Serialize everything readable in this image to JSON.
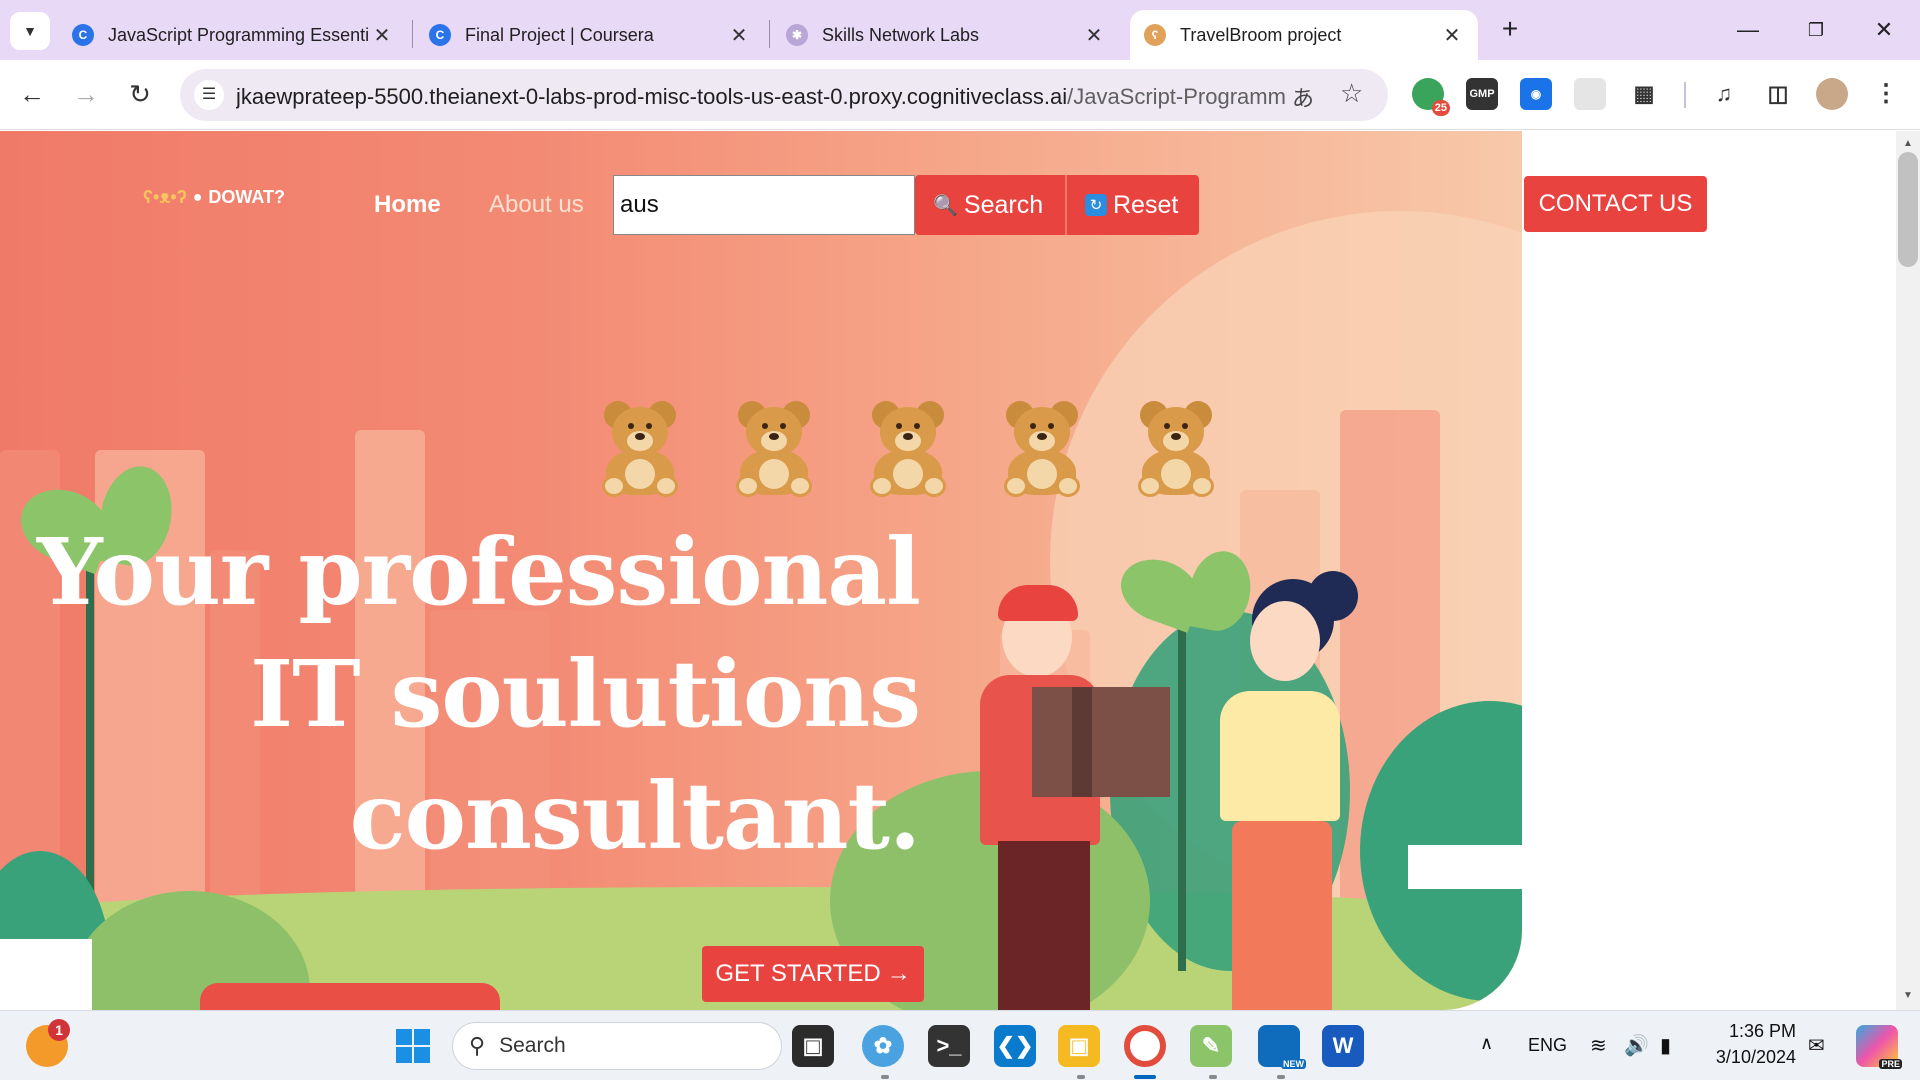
{
  "browser": {
    "tabs": [
      {
        "title": "JavaScript Programming Essenti",
        "favicon": "coursera-icon",
        "active": false
      },
      {
        "title": "Final Project | Coursera",
        "favicon": "coursera-icon",
        "active": false
      },
      {
        "title": "Skills Network Labs",
        "favicon": "skills-network-icon",
        "active": false
      },
      {
        "title": "TravelBroom project",
        "favicon": "bear-icon",
        "active": true
      }
    ],
    "close_glyph": "✕",
    "new_tab_glyph": "+",
    "url_host": "jkaewprateep-5500.theianext-0-labs-prod-misc-tools-us-east-0.proxy.cognitiveclass.ai",
    "url_path": "/JavaScript-Programming...",
    "extension_badge": "25",
    "extension_gmp": "GMP"
  },
  "page": {
    "logo_text": "DOWAT?",
    "nav": {
      "home": "Home",
      "about": "About us"
    },
    "search": {
      "value": "aus",
      "button": "Search",
      "reset": "Reset"
    },
    "contact": "CONTACT US",
    "headline": [
      "Your professional",
      "IT soulutions",
      "consultant."
    ],
    "cta": "GET STARTED",
    "cta_arrow": "→",
    "bear_count": 5,
    "colors": {
      "accent": "#e8433f",
      "hero_start": "#f07a68",
      "hero_end": "#f8c8aa"
    }
  },
  "taskbar": {
    "search_label": "Search",
    "weather_badge": "1",
    "language": "ENG",
    "time": "1:36 PM",
    "date": "3/10/2024",
    "outlook_badge": "NEW",
    "copilot_badge": "PRE"
  }
}
